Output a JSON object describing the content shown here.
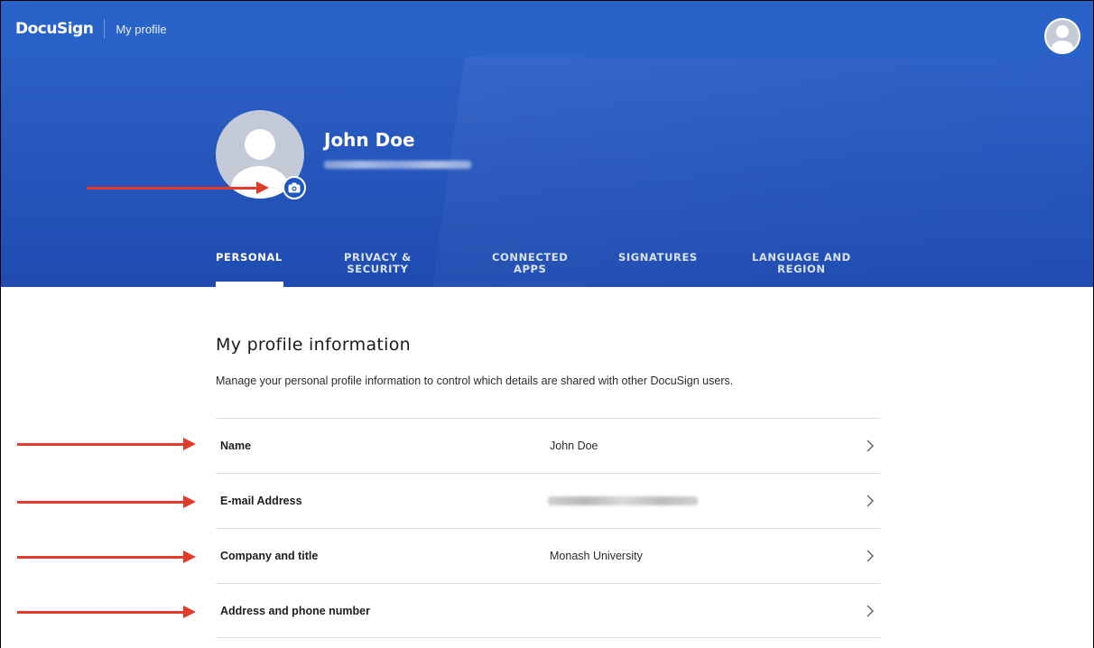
{
  "topbar": {
    "brand": "DocuSign",
    "title": "My profile"
  },
  "profile": {
    "name": "John Doe"
  },
  "tabs": [
    {
      "label_line1": "PERSONAL",
      "label_line2": "",
      "active": true
    },
    {
      "label_line1": "PRIVACY &",
      "label_line2": "SECURITY",
      "active": false
    },
    {
      "label_line1": "CONNECTED",
      "label_line2": "APPS",
      "active": false
    },
    {
      "label_line1": "SIGNATURES",
      "label_line2": "",
      "active": false
    },
    {
      "label_line1": "LANGUAGE AND",
      "label_line2": "REGION",
      "active": false
    }
  ],
  "section": {
    "title": "My profile information",
    "description": "Manage your personal profile information to control which details are shared with other DocuSign users."
  },
  "rows": [
    {
      "label": "Name",
      "value": "John Doe"
    },
    {
      "label": "E-mail Address",
      "value": ""
    },
    {
      "label": "Company and title",
      "value": "Monash University"
    },
    {
      "label": "Address and phone number",
      "value": ""
    }
  ],
  "icons": {
    "camera": "camera-icon",
    "chevron": "chevron-right-icon",
    "avatar": "user-avatar-icon"
  },
  "colors": {
    "brand_blue": "#2a63c8",
    "annotation_red": "#e23a2b"
  }
}
